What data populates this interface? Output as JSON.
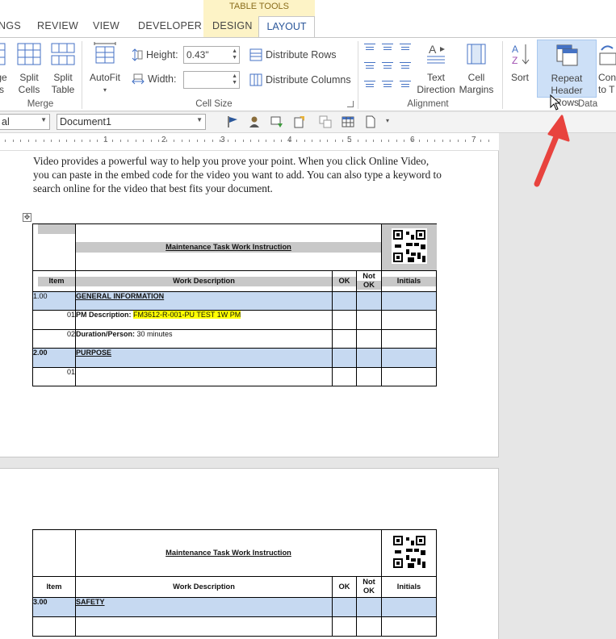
{
  "ribbon_tabs": {
    "contextual_title": "TABLE TOOLS",
    "items": [
      "NGS",
      "REVIEW",
      "VIEW",
      "DEVELOPER",
      "DESIGN",
      "LAYOUT"
    ],
    "active": "LAYOUT"
  },
  "ribbon": {
    "merge_group": {
      "label": "Merge",
      "partial_button_line1": "ge",
      "partial_button_line2": "s",
      "split_cells_line1": "Split",
      "split_cells_line2": "Cells",
      "split_table_line1": "Split",
      "split_table_line2": "Table"
    },
    "cell_size_group": {
      "label": "Cell Size",
      "autofit": "AutoFit",
      "height_label": "Height:",
      "height_value": "0.43\"",
      "width_label": "Width:",
      "width_value": "",
      "distribute_rows": "Distribute Rows",
      "distribute_columns": "Distribute Columns"
    },
    "alignment_group": {
      "label": "Alignment",
      "text_direction_line1": "Text",
      "text_direction_line2": "Direction",
      "cell_margins_line1": "Cell",
      "cell_margins_line2": "Margins"
    },
    "data_group": {
      "label": "Data",
      "sort": "Sort",
      "repeat_header_rows_line1": "Repeat",
      "repeat_header_rows_line2": "Header Rows",
      "convert_line1": "Con",
      "convert_line2": "to T"
    }
  },
  "quick_toolbar": {
    "style_combo_value": "al",
    "document_combo_value": "Document1"
  },
  "ruler": {
    "numbers": [
      "1",
      "2",
      "3",
      "4",
      "5",
      "6",
      "7"
    ]
  },
  "document": {
    "paragraph_lines": [
      "Video provides a powerful way to help you prove your point. When you click Online Video,",
      "you can paste in the embed code for the video you want to add. You can also type a keyword to",
      "search online for the video that best fits your document."
    ],
    "table": {
      "title": "Maintenance Task Work Instruction",
      "col_item": "Item",
      "col_desc": "Work Description",
      "col_ok": "OK",
      "col_notok_line1": "Not",
      "col_notok_line2": "OK",
      "col_initials": "Initials",
      "page1_rows": [
        {
          "item": "1.00",
          "desc": "GENERAL INFORMATION",
          "section": true
        },
        {
          "item": "01",
          "desc_label": "PM Description: ",
          "desc_value": "FM3612-R-001-PU TEST 1W PM"
        },
        {
          "item": "02",
          "desc_label": "Duration/Person: ",
          "desc_value": "30 minutes"
        },
        {
          "item": "2.00",
          "desc": "PURPOSE",
          "section": true
        },
        {
          "item": "01",
          "desc": ""
        }
      ],
      "page2_rows": [
        {
          "item": "3.00",
          "desc": "SAFETY",
          "section": true
        },
        {
          "item": "",
          "desc": ""
        }
      ]
    }
  },
  "colors": {
    "accent": "#2b579a",
    "contextual_band": "#fdf3c6",
    "selected_button": "#cde0f7",
    "section_row": "#c6d9f1",
    "highlight": "#ffff00",
    "arrow": "#e8433e"
  }
}
